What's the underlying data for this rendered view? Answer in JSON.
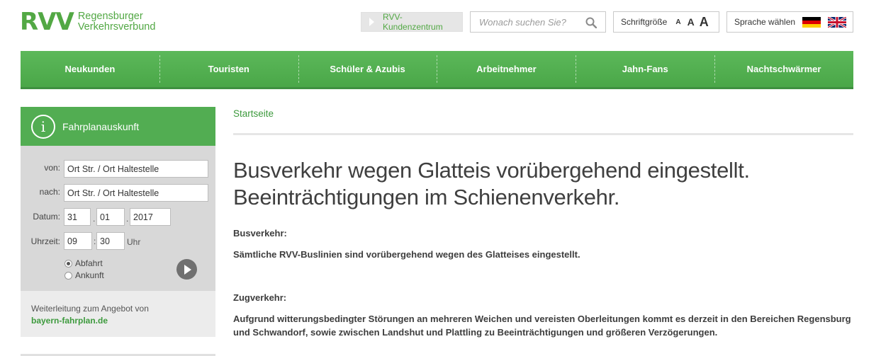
{
  "header": {
    "logo_mark": "RVV",
    "logo_line1": "Regensburger",
    "logo_line2": "Verkehrsverbund",
    "kundenzentrum": "RVV-Kundenzentrum",
    "search_placeholder": "Wonach suchen Sie?",
    "fontsize_label": "Schriftgröße",
    "fontsize_options": [
      "A",
      "A",
      "A"
    ],
    "language_label": "Sprache wählen",
    "icons": {
      "search": "search-icon",
      "de": "german-flag-icon",
      "en": "uk-flag-icon"
    }
  },
  "nav": [
    "Neukunden",
    "Touristen",
    "Schüler & Azubis",
    "Arbeitnehmer",
    "Jahn-Fans",
    "Nachtschwärmer"
  ],
  "planner": {
    "title": "Fahrplanauskunft",
    "info_glyph": "i",
    "from_label": "von:",
    "from_value": "Ort Str. / Ort Haltestelle",
    "to_label": "nach:",
    "to_value": "Ort Str. / Ort Haltestelle",
    "date_label": "Datum:",
    "day": "31",
    "month": "01",
    "year": "2017",
    "time_label": "Uhrzeit:",
    "hour": "09",
    "minute": "30",
    "time_unit": "Uhr",
    "departure": "Abfahrt",
    "arrival": "Ankunft",
    "footer_text": "Weiterleitung zum Angebot von",
    "footer_link": "bayern-fahrplan.de"
  },
  "main": {
    "breadcrumb": "Startseite",
    "headline_1": "Busverkehr wegen Glatteis vorübergehend eingestellt.",
    "headline_2": "Beeinträchtigungen im Schienenverkehr.",
    "bus_heading": "Busverkehr:",
    "bus_text": "Sämtliche RVV-Buslinien sind vorübergehend wegen des Glatteises eingestellt.",
    "rail_heading": "Zugverkehr:",
    "rail_text": "Aufgrund witterungsbedingter Störungen an mehreren Weichen und vereisten Oberleitungen kommt es derzeit in den Bereichen Regensburg und Schwandorf, sowie zwischen Landshut und Plattling zu Beeinträchtigungen und größeren Verzögerungen."
  },
  "colors": {
    "brand_green": "#52ad52",
    "link_green": "#3d9a3d"
  }
}
